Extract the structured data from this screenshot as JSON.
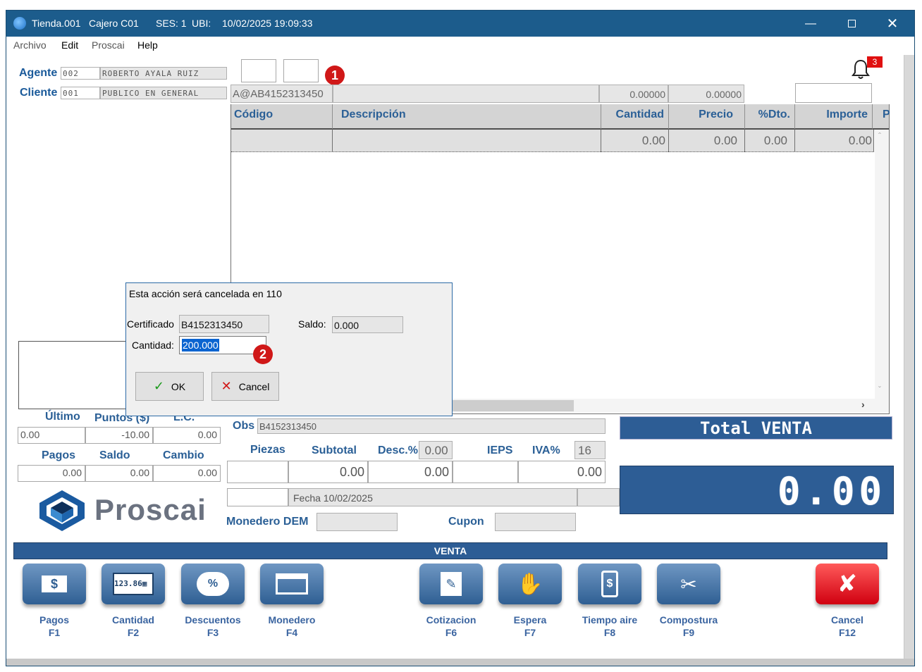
{
  "titlebar": {
    "tienda": "Tienda.001",
    "cajero": "Cajero C01",
    "ses": "SES: 1",
    "ubi": "UBI:",
    "datetime": "10/02/2025 19:09:33"
  },
  "menu": [
    "Archivo",
    "Edit",
    "Proscai",
    "Help"
  ],
  "agente": {
    "label": "Agente",
    "code": "002",
    "name": "ROBERTO AYALA RUIZ"
  },
  "cliente": {
    "label": "Cliente",
    "code": "001",
    "name": "PUBLICO EN GENERAL"
  },
  "scan": {
    "code": "A@AB4152313450",
    "val1": "0.00000",
    "val2": "0.00000"
  },
  "notifications": {
    "count": "3"
  },
  "markers": {
    "m1": "1",
    "m2": "2"
  },
  "grid": {
    "headers": {
      "codigo": "Código",
      "descripcion": "Descripción",
      "cantidad": "Cantidad",
      "precio": "Precio",
      "dto": "%Dto.",
      "importe": "Importe",
      "extra": "P"
    },
    "row": {
      "cantidad": "0.00",
      "precio": "0.00",
      "dto": "0.00",
      "importe": "0.00"
    }
  },
  "left_summary": {
    "ultimo_label": "Último",
    "puntos_label": "Puntos ($)",
    "lc_label": "L.C.",
    "ultimo": "0.00",
    "puntos": "-10.00",
    "lc": "0.00",
    "pagos_label": "Pagos",
    "saldo_label": "Saldo",
    "cambio_label": "Cambio",
    "pagos": "0.00",
    "saldo": "0.00",
    "cambio": "0.00"
  },
  "brand": {
    "name": "Proscai"
  },
  "obs": {
    "label": "Obs",
    "value": "B4152313450"
  },
  "totals": {
    "piezas_label": "Piezas",
    "subtotal_label": "Subtotal",
    "desc_label": "Desc.%",
    "desc_value": "0.00",
    "ieps_label": "IEPS",
    "iva_label": "IVA%",
    "iva_value": "16",
    "subtotal": "0.00",
    "desc": "0.00",
    "ieps": "0.00",
    "fecha": "Fecha 10/02/2025",
    "monedero_label": "Monedero DEM",
    "cupon_label": "Cupon"
  },
  "total_venta": {
    "label": "Total VENTA",
    "value": "0.00"
  },
  "section_label": "VENTA",
  "toolbar": [
    {
      "name": "Pagos",
      "key": "F1"
    },
    {
      "name": "Cantidad",
      "key": "F2"
    },
    {
      "name": "Descuentos",
      "key": "F3"
    },
    {
      "name": "Monedero",
      "key": "F4"
    },
    {
      "name": "Cotizacion",
      "key": "F6"
    },
    {
      "name": "Espera",
      "key": "F7"
    },
    {
      "name": "Tiempo aire",
      "key": "F8"
    },
    {
      "name": "Compostura",
      "key": "F9"
    },
    {
      "name": "Cancel",
      "key": "F12"
    }
  ],
  "dialog": {
    "title": "Esta acción será cancelada en 110",
    "cert_label": "Certificado",
    "cert_value": "B4152313450",
    "saldo_label": "Saldo:",
    "saldo_value": "0.000",
    "cantidad_label": "Cantidad:",
    "cantidad_value": "200.000",
    "ok_label": "OK",
    "cancel_label": "Cancel"
  },
  "colors": {
    "titlebar": "#1c5c8c",
    "accent_blue": "#2a5f96",
    "total_panel": "#2d5d95",
    "marker_red": "#d01818",
    "cancel_red": "#e01020"
  }
}
